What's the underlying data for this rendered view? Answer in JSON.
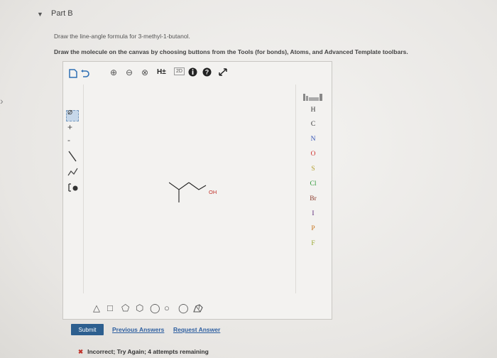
{
  "part": {
    "toggle_icon": "triangle-down",
    "title": "Part B",
    "prompt_line1": "Draw the line-angle formula for 3-methyl-1-butanol.",
    "prompt_line2": "Draw the molecule on the canvas by choosing buttons from the Tools (for bonds), Atoms, and Advanced Template toolbars."
  },
  "toolbar": {
    "hydrogen_label": "H±",
    "charge_label": "2D"
  },
  "left_tools": {
    "plus_label": "+",
    "minus_label": "-"
  },
  "molecule": {
    "oh_label": "OH"
  },
  "atoms": [
    "H",
    "C",
    "N",
    "O",
    "S",
    "Cl",
    "Br",
    "I",
    "P",
    "F"
  ],
  "colors": {
    "H": "#333333",
    "C": "#333333",
    "N": "#2e4fb4",
    "O": "#d0312d",
    "S": "#b5a031",
    "Cl": "#2f9a3a",
    "Br": "#8a3a2a",
    "I": "#5b2a7a",
    "P": "#c8761f",
    "F": "#9aa830",
    "submit": "#2d5f8f",
    "link": "#2e5fa0",
    "error": "#c0322a"
  },
  "actions": {
    "submit_label": "Submit",
    "previous_answers_label": "Previous Answers",
    "request_answer_label": "Request Answer"
  },
  "feedback": {
    "icon": "x-icon",
    "message": "Incorrect; Try Again; 4 attempts remaining"
  }
}
